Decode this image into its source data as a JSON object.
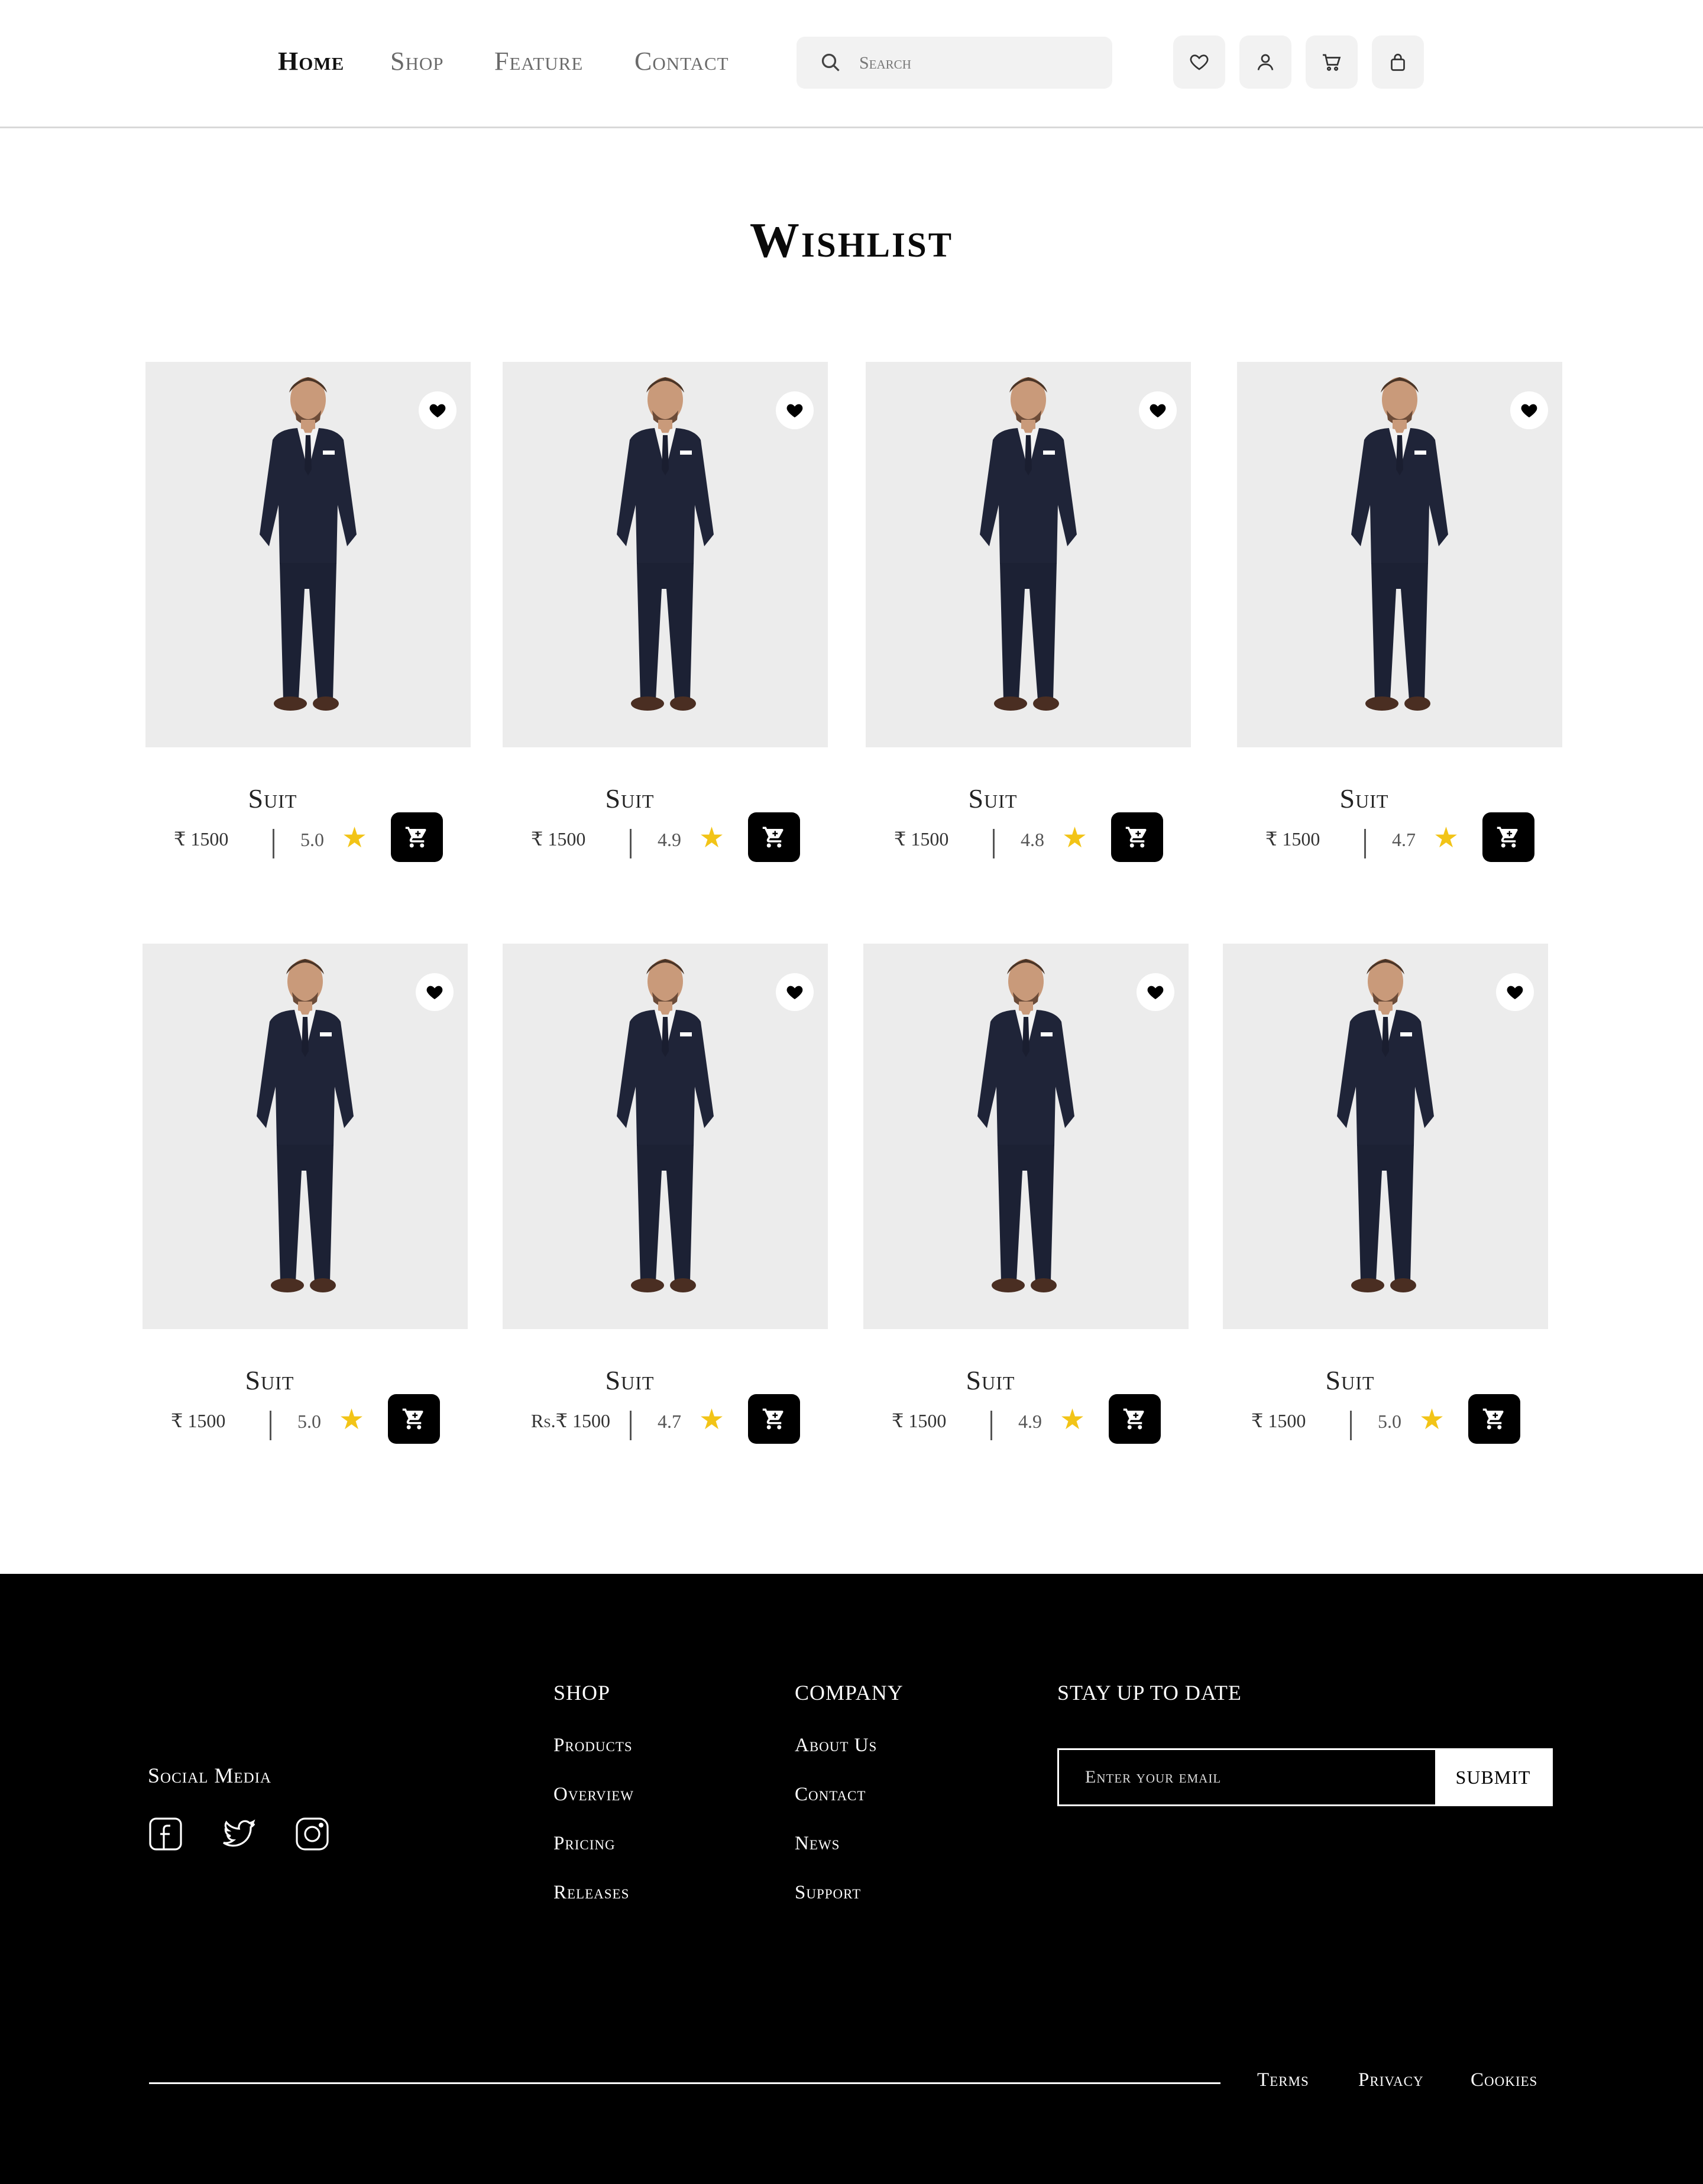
{
  "nav": {
    "links": [
      "Home",
      "Shop",
      "Feature",
      "Contact"
    ],
    "search_placeholder": "Search"
  },
  "header_icons": [
    "heart-icon",
    "user-icon",
    "cart-icon",
    "bag-icon"
  ],
  "page": {
    "title": "Wishlist"
  },
  "products": [
    {
      "name": "Suit",
      "price": "₹ 1500",
      "rating": "5.0"
    },
    {
      "name": "Suit",
      "price": "₹ 1500",
      "rating": "4.9"
    },
    {
      "name": "Suit",
      "price": "₹ 1500",
      "rating": "4.8"
    },
    {
      "name": "Suit",
      "price": "₹ 1500",
      "rating": "4.7"
    },
    {
      "name": "Suit",
      "price": "₹ 1500",
      "rating": "5.0"
    },
    {
      "name": "Suit",
      "price": "Rs.₹ 1500",
      "rating": "4.7"
    },
    {
      "name": "Suit",
      "price": "₹ 1500",
      "rating": "4.9"
    },
    {
      "name": "Suit",
      "price": "₹ 1500",
      "rating": "5.0"
    }
  ],
  "footer": {
    "social_title": "Social Media",
    "social_icons": [
      "facebook-icon",
      "twitter-icon",
      "instagram-icon"
    ],
    "shop": {
      "title": "SHOP",
      "links": [
        "Products",
        "Overview",
        "Pricing",
        "Releases"
      ]
    },
    "company": {
      "title": "COMPANY",
      "links": [
        "About Us",
        "Contact",
        "News",
        "Support"
      ]
    },
    "newsletter": {
      "title": "STAY UP TO DATE",
      "placeholder": "Enter your email",
      "submit": "SUBMIT"
    },
    "legal": [
      "Terms",
      "Privacy",
      "Cookies"
    ]
  },
  "colors": {
    "accent_star": "#f2c417",
    "footer_bg": "#000000",
    "card_bg": "#ececec"
  }
}
